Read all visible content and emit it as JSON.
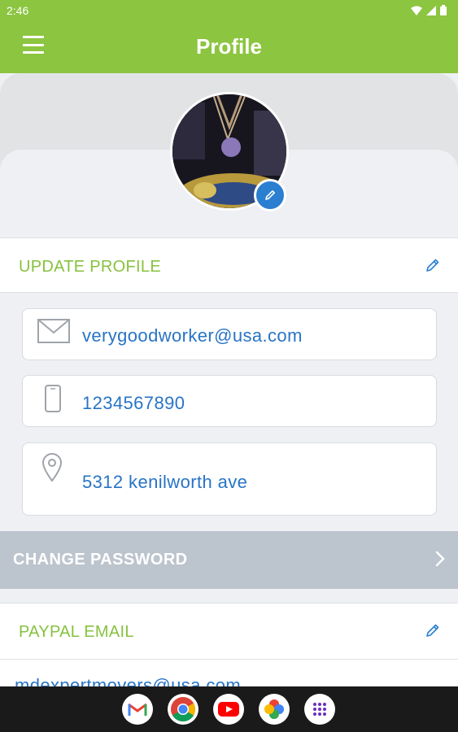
{
  "status_bar": {
    "time": "2:46",
    "icons": [
      "wifi-icon",
      "signal-icon",
      "battery-icon"
    ]
  },
  "app_bar": {
    "title": "Profile",
    "menu_icon": "hamburger-menu-icon"
  },
  "colors": {
    "primary_green": "#8cc540",
    "accent_blue": "#2b7fd1",
    "value_blue": "#2874c5",
    "section_label_green": "#86c23e",
    "change_password_bg": "#bcc4cd"
  },
  "profile": {
    "avatar": "profile-photo",
    "edit_icon": "pencil-icon"
  },
  "update_profile": {
    "label": "UPDATE PROFILE",
    "fields": [
      {
        "icon": "envelope-icon",
        "value": "verygoodworker@usa.com"
      },
      {
        "icon": "phone-icon",
        "value": "1234567890"
      },
      {
        "icon": "location-pin-icon",
        "value": "5312 kenilworth ave"
      }
    ]
  },
  "change_password": {
    "label": "CHANGE PASSWORD",
    "icon": "chevron-right-icon"
  },
  "paypal": {
    "label": "PAYPAL EMAIL",
    "value": "mdexpertmovers@usa.com"
  },
  "dock": {
    "apps": [
      "gmail-icon",
      "chrome-icon",
      "youtube-icon",
      "photos-icon",
      "app-drawer-icon"
    ]
  }
}
